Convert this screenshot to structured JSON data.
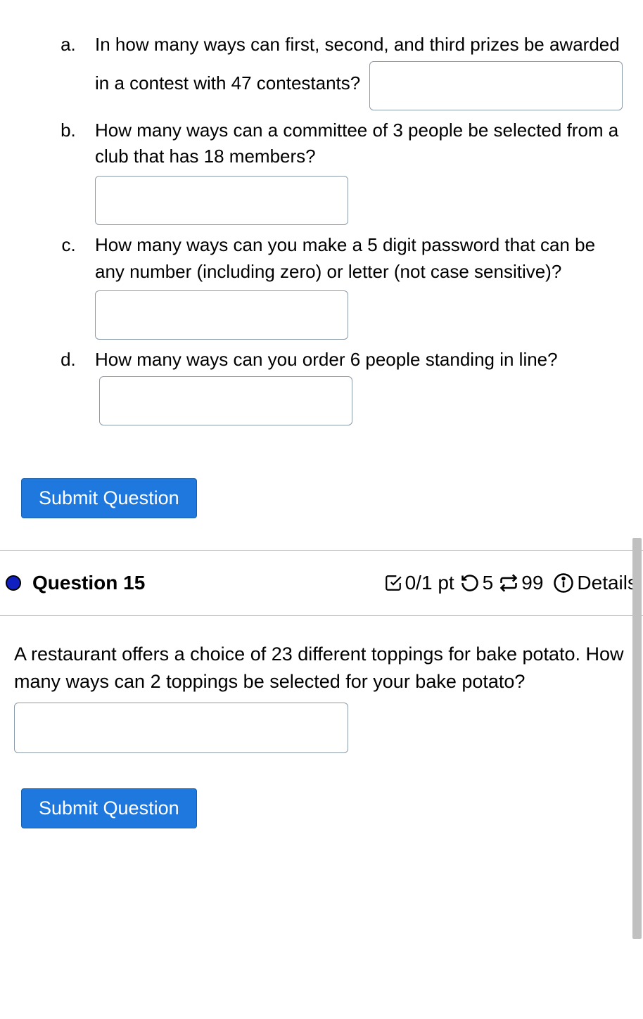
{
  "q14": {
    "a": "In how many ways can first, second, and third prizes be awarded in a contest with 47 contestants?",
    "b": "How many ways can a committee of 3 people be selected from a club that has 18 members?",
    "c": "How many ways can you make a 5 digit password that can be any number (including zero) or letter (not case sensitive)?",
    "d": "How many ways can you order 6 people standing in line?"
  },
  "submit_label": "Submit Question",
  "question15": {
    "title": "Question 15",
    "points": "0/1 pt",
    "attempts_left": "5",
    "tries": "99",
    "details_label": "Details",
    "text": "A restaurant offers a choice of 23 different toppings for bake potato. How many ways can 2 toppings be selected for your bake potato?"
  }
}
